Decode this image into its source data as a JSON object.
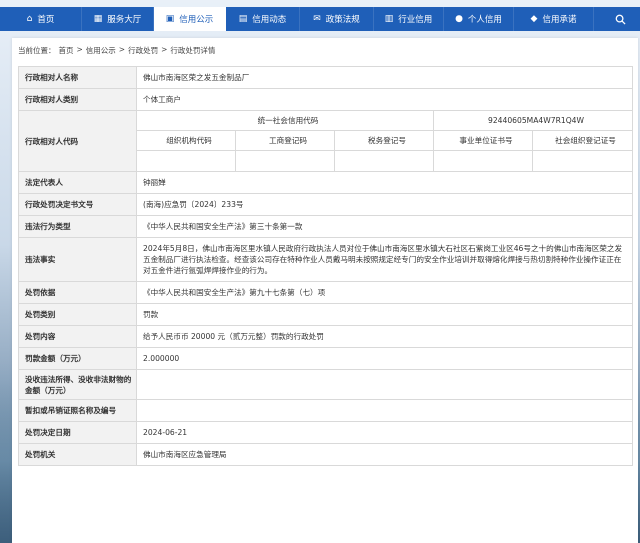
{
  "nav": {
    "items": [
      {
        "label": "首页",
        "icon": "⌂"
      },
      {
        "label": "服务大厅",
        "icon": "▦"
      },
      {
        "label": "信用公示",
        "icon": "▣"
      },
      {
        "label": "信用动态",
        "icon": "▤"
      },
      {
        "label": "政策法规",
        "icon": "✉"
      },
      {
        "label": "行业信用",
        "icon": "▥"
      },
      {
        "label": "个人信用",
        "icon": "●"
      },
      {
        "label": "信用承诺",
        "icon": "◆"
      }
    ],
    "search_icon": "search-icon",
    "active_color": "#1f5fb8"
  },
  "breadcrumb": {
    "prefix": "当前位置：",
    "items": [
      "首页",
      "信用公示",
      "行政处罚",
      "行政处罚详情"
    ],
    "sep": ">"
  },
  "details": {
    "name_label": "行政相对人名称",
    "name_value": "佛山市南海区荣之发五金制品厂",
    "category_label": "行政相对人类别",
    "category_value": "个体工商户",
    "code_label": "行政相对人代码",
    "uscc_label": "统一社会信用代码",
    "uscc_value": "92440605MA4W7R1Q4W",
    "sub_headers": [
      "组织机构代码",
      "工商登记码",
      "税务登记号",
      "事业单位证书号",
      "社会组织登记证号"
    ],
    "legal_label": "法定代表人",
    "legal_value": "钟丽婵",
    "doc_label": "行政处罚决定书文号",
    "doc_value": "(南海)应急罚〔2024〕233号",
    "violation_type_label": "违法行为类型",
    "violation_type_value": "《中华人民共和国安全生产法》第三十条第一款",
    "facts_label": "违法事实",
    "facts_value": "2024年5月8日，佛山市南海区里水镇人民政府行政执法人员对位于佛山市南海区里水镇大石社区石紫岗工业区46号之十的佛山市南海区荣之发五金制品厂进行执法检查。经查该公司存在特种作业人员戴马明未按照规定经专门的安全作业培训并取得熔化焊接与热切割特种作业操作证正在对五金件进行氩弧焊焊接作业的行为。",
    "basis_label": "处罚依据",
    "basis_value": "《中华人民共和国安全生产法》第九十七条第（七）项",
    "ptype_label": "处罚类别",
    "ptype_value": "罚款",
    "content_label": "处罚内容",
    "content_value": "给予人民币币 20000 元（贰万元整）罚款的行政处罚",
    "amount_label": "罚款金额（万元）",
    "amount_value": "2.000000",
    "confiscate_label": "没收违法所得、没收非法财物的金额（万元）",
    "confiscate_value": "",
    "license_label": "暂扣或吊销证照名称及编号",
    "license_value": "",
    "date_label": "处罚决定日期",
    "date_value": "2024-06-21",
    "org_label": "处罚机关",
    "org_value": "佛山市南海区应急管理局"
  }
}
